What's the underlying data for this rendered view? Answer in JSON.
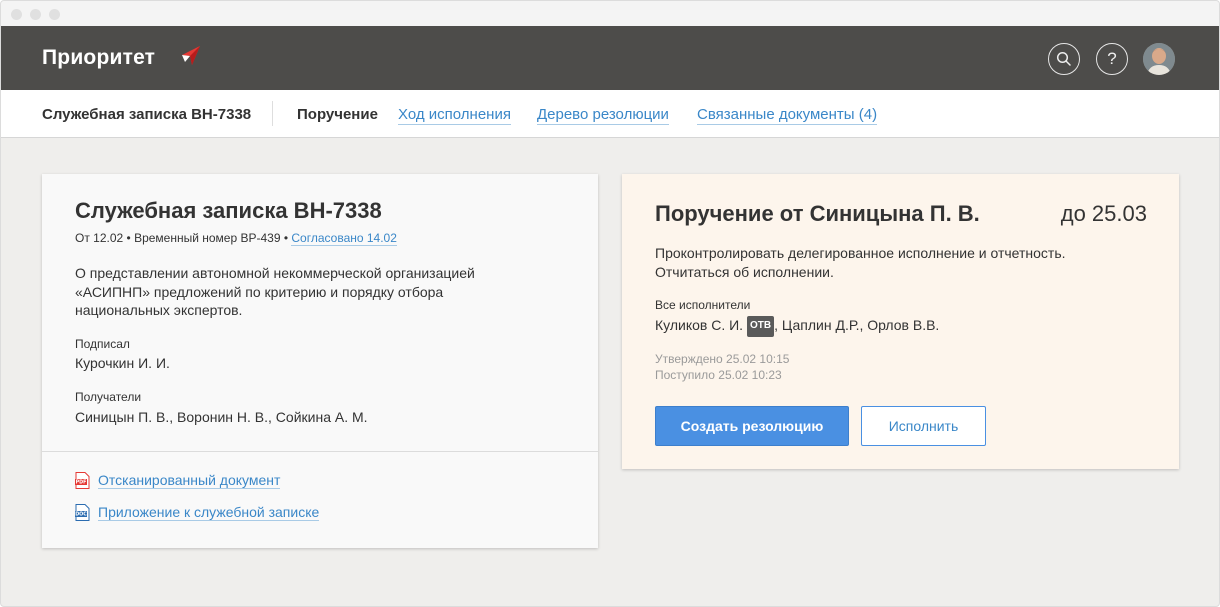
{
  "app": {
    "name": "Приоритет",
    "brand_accent": "#e53935"
  },
  "header": {
    "search_icon": "search-icon",
    "help_label": "?",
    "avatar_icon": "user-avatar"
  },
  "tabbar": {
    "doc_title": "Служебная записка ВН-7338",
    "tabs": [
      {
        "label": "Поручение",
        "active": true
      },
      {
        "label": "Ход исполнения",
        "active": false
      },
      {
        "label": "Дерево резолюции",
        "active": false
      },
      {
        "label": "Связанные документы (4)",
        "active": false
      }
    ]
  },
  "document": {
    "title": "Служебная записка ВН-7338",
    "meta_text": "От 12.02 • Временный номер ВР-439 •",
    "meta_link": "Согласовано 14.02",
    "description_lines": [
      "О представлении автономной некоммерческой организацией",
      "«АСИПНП» предложений по критерию и порядку отбора",
      "национальных экспертов."
    ],
    "signed_label": "Подписал",
    "signed_value": "Курочкин И. И.",
    "recipients_label": "Получатели",
    "recipients_value": "Синицын П. В., Воронин Н. В., Сойкина А. М.",
    "attachments": [
      {
        "label": "Отсканированный документ",
        "icon": "pdf-file-icon",
        "type": "PDF",
        "color": "#e53935"
      },
      {
        "label": "Приложение к служебной записке",
        "icon": "doc-file-icon",
        "type": "DOC",
        "color": "#2b6cb0"
      }
    ]
  },
  "assignment": {
    "title": "Поручение от Синицына П. В.",
    "deadline": "до 25.03",
    "text_lines": [
      "Проконтролировать делегированное исполнение и отчетность.",
      "Отчитаться об исполнении."
    ],
    "executors_label": "Все исполнители",
    "executor_main": "Куликов С. И.",
    "executor_badge": "ОТВ",
    "executors_rest": ", Цаплин Д.Р., Орлов В.В.",
    "approved": "Утверждено 25.02 10:15",
    "received": "Поступило 25.02 10:23",
    "create_button": "Создать резолюцию",
    "execute_button": "Исполнить"
  }
}
